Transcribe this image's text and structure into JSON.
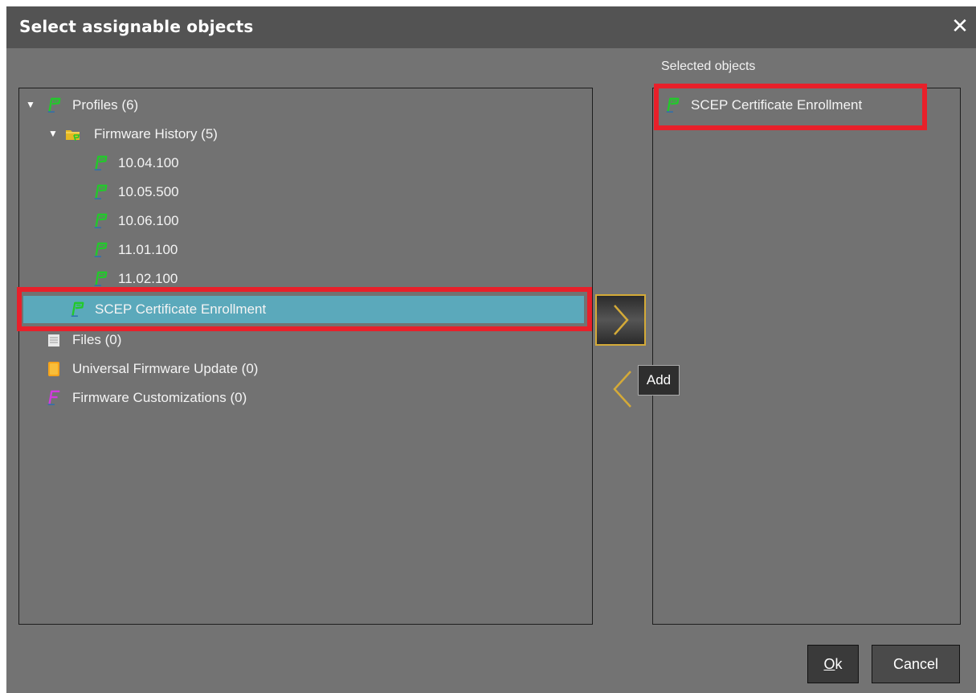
{
  "dialog": {
    "title": "Select assignable objects",
    "close_glyph": "✕"
  },
  "tree": {
    "items": [
      {
        "label": "Profiles (6)",
        "icon": "profile-icon",
        "expanded": true
      },
      {
        "label": "Firmware History (5)",
        "icon": "folder-icon",
        "expanded": true
      },
      {
        "label": "10.04.100",
        "icon": "profile-icon"
      },
      {
        "label": "10.05.500",
        "icon": "profile-icon"
      },
      {
        "label": "10.06.100",
        "icon": "profile-icon"
      },
      {
        "label": "11.01.100",
        "icon": "profile-icon"
      },
      {
        "label": "11.02.100",
        "icon": "profile-icon"
      },
      {
        "label": "SCEP Certificate Enrollment",
        "icon": "profile-icon",
        "selected": true
      },
      {
        "label": "Files (0)",
        "icon": "file-icon"
      },
      {
        "label": "Universal Firmware Update (0)",
        "icon": "update-icon"
      },
      {
        "label": "Firmware Customizations (0)",
        "icon": "customization-icon"
      }
    ]
  },
  "selected": {
    "header": "Selected objects",
    "items": [
      {
        "label": "SCEP Certificate Enrollment",
        "icon": "profile-icon"
      }
    ]
  },
  "transfer": {
    "tooltip": "Add"
  },
  "buttons": {
    "ok_mnemonic": "O",
    "ok_rest": "k",
    "cancel": "Cancel"
  },
  "colors": {
    "dialog_bg": "#737373",
    "titlebar_bg": "#535353",
    "selection_bg": "#5ba9bb",
    "highlight_red": "#e8202a",
    "accent_gold": "#d4aa38",
    "profile_green": "#22c92b"
  }
}
